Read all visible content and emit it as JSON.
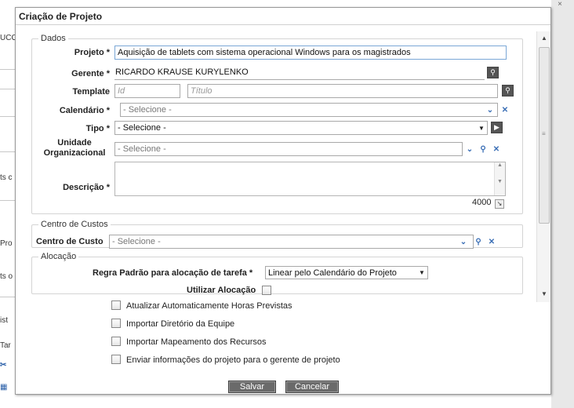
{
  "background": {
    "items": [
      "UCO",
      "ts c",
      "Pro",
      "ts o",
      "ist",
      "Tar"
    ]
  },
  "dialog": {
    "title": "Criação de Projeto",
    "dados": {
      "legend": "Dados",
      "projeto": {
        "label": "Projeto *",
        "value": "Aquisição de tablets com sistema operacional Windows para os magistrados"
      },
      "gerente": {
        "label": "Gerente *",
        "value": "RICARDO KRAUSE KURYLENKO"
      },
      "template": {
        "label": "Template",
        "id_placeholder": "Id",
        "title_placeholder": "Título"
      },
      "calendario": {
        "label": "Calendário *",
        "value": "- Selecione -"
      },
      "tipo": {
        "label": "Tipo *",
        "value": "- Selecione -"
      },
      "unidade": {
        "label_line1": "Unidade",
        "label_line2": "Organizacional",
        "value": "- Selecione -"
      },
      "descricao": {
        "label": "Descrição *",
        "counter": "4000"
      }
    },
    "centro_custos": {
      "legend": "Centro de Custos",
      "label": "Centro de Custo",
      "value": "- Selecione -"
    },
    "alocacao": {
      "legend": "Alocação",
      "regra_label": "Regra Padrão para alocação de tarefa *",
      "regra_value": "Linear pelo Calendário do Projeto",
      "utilizar_label": "Utilizar Alocação"
    },
    "checkboxes": [
      "Atualizar Automaticamente Horas Previstas",
      "Importar Diretório da Equipe",
      "Importar Mapeamento dos Recursos",
      "Enviar informações do projeto para o gerente de projeto"
    ],
    "buttons": {
      "save": "Salvar",
      "cancel": "Cancelar"
    }
  },
  "colors": {
    "button_bg": "#6a6a6a",
    "focus_border": "#7aa7d6",
    "border": "#a9a9a9"
  }
}
